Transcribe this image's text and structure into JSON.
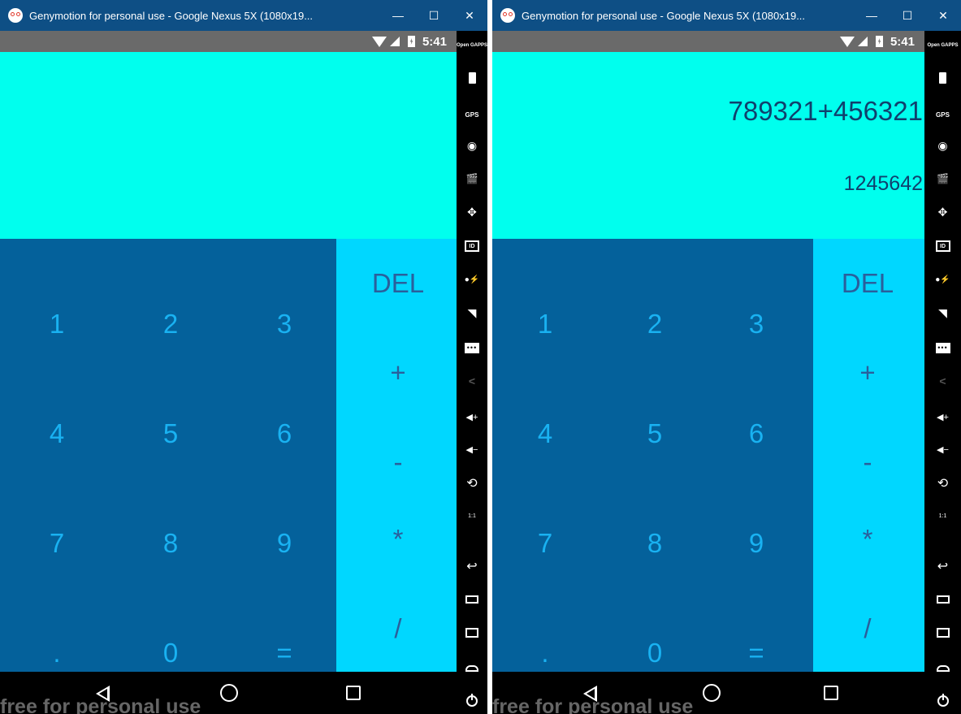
{
  "windows": [
    {
      "title": "Genymotion for personal use - Google Nexus 5X (1080x19...",
      "status": {
        "time": "5:41"
      },
      "display": {
        "expression": "",
        "result": ""
      },
      "numpad": [
        {
          "label": "1",
          "name": "key-1"
        },
        {
          "label": "2",
          "name": "key-2"
        },
        {
          "label": "3",
          "name": "key-3"
        },
        {
          "label": "4",
          "name": "key-4"
        },
        {
          "label": "5",
          "name": "key-5"
        },
        {
          "label": "6",
          "name": "key-6"
        },
        {
          "label": "7",
          "name": "key-7"
        },
        {
          "label": "8",
          "name": "key-8"
        },
        {
          "label": "9",
          "name": "key-9"
        },
        {
          "label": ".",
          "name": "key-decimal"
        },
        {
          "label": "0",
          "name": "key-0"
        },
        {
          "label": "=",
          "name": "key-equals"
        }
      ],
      "operators": [
        {
          "label": "DEL",
          "name": "key-delete"
        },
        {
          "label": "+",
          "name": "key-plus"
        },
        {
          "label": "-",
          "name": "key-minus"
        },
        {
          "label": "*",
          "name": "key-multiply"
        },
        {
          "label": "/",
          "name": "key-divide"
        }
      ],
      "watermark": "free for personal use"
    },
    {
      "title": "Genymotion for personal use - Google Nexus 5X (1080x19...",
      "status": {
        "time": "5:41"
      },
      "display": {
        "expression": "789321+456321",
        "result": "1245642"
      },
      "numpad": [
        {
          "label": "1",
          "name": "key-1"
        },
        {
          "label": "2",
          "name": "key-2"
        },
        {
          "label": "3",
          "name": "key-3"
        },
        {
          "label": "4",
          "name": "key-4"
        },
        {
          "label": "5",
          "name": "key-5"
        },
        {
          "label": "6",
          "name": "key-6"
        },
        {
          "label": "7",
          "name": "key-7"
        },
        {
          "label": "8",
          "name": "key-8"
        },
        {
          "label": "9",
          "name": "key-9"
        },
        {
          "label": ".",
          "name": "key-decimal"
        },
        {
          "label": "0",
          "name": "key-0"
        },
        {
          "label": "=",
          "name": "key-equals"
        }
      ],
      "operators": [
        {
          "label": "DEL",
          "name": "key-delete"
        },
        {
          "label": "+",
          "name": "key-plus"
        },
        {
          "label": "-",
          "name": "key-minus"
        },
        {
          "label": "*",
          "name": "key-multiply"
        },
        {
          "label": "/",
          "name": "key-divide"
        }
      ],
      "watermark": "free for personal use"
    }
  ],
  "window_controls": {
    "minimize": "—",
    "maximize": "☐",
    "close": "✕"
  },
  "sidebar": [
    {
      "icon": "open-gapps-icon",
      "text": "Open GAPPS"
    },
    {
      "icon": "battery-icon"
    },
    {
      "icon": "gps-icon",
      "text": "GPS"
    },
    {
      "icon": "webcam-icon"
    },
    {
      "icon": "screencast-icon"
    },
    {
      "icon": "remote-control-icon"
    },
    {
      "icon": "device-id-icon",
      "text": "ID"
    },
    {
      "icon": "disk-io-icon"
    },
    {
      "icon": "network-icon"
    },
    {
      "icon": "sms-icon"
    },
    {
      "icon": "share-icon"
    },
    {
      "icon": "volume-up-icon"
    },
    {
      "icon": "volume-down-icon"
    },
    {
      "icon": "rotate-icon"
    },
    {
      "icon": "pixel-perfect-icon",
      "text": "1:1"
    },
    {
      "icon": "back-icon"
    },
    {
      "icon": "recent-apps-icon"
    },
    {
      "icon": "menu-icon"
    },
    {
      "icon": "home-icon"
    },
    {
      "icon": "power-icon"
    }
  ],
  "colors": {
    "titlebar": "#0e4f85",
    "display_bg": "#00ffee",
    "display_text": "#10406d",
    "numpad_bg": "#04619b",
    "numpad_text": "#19b2f2",
    "operator_bg": "#00d7ff",
    "operator_text": "#2a5f9c"
  }
}
